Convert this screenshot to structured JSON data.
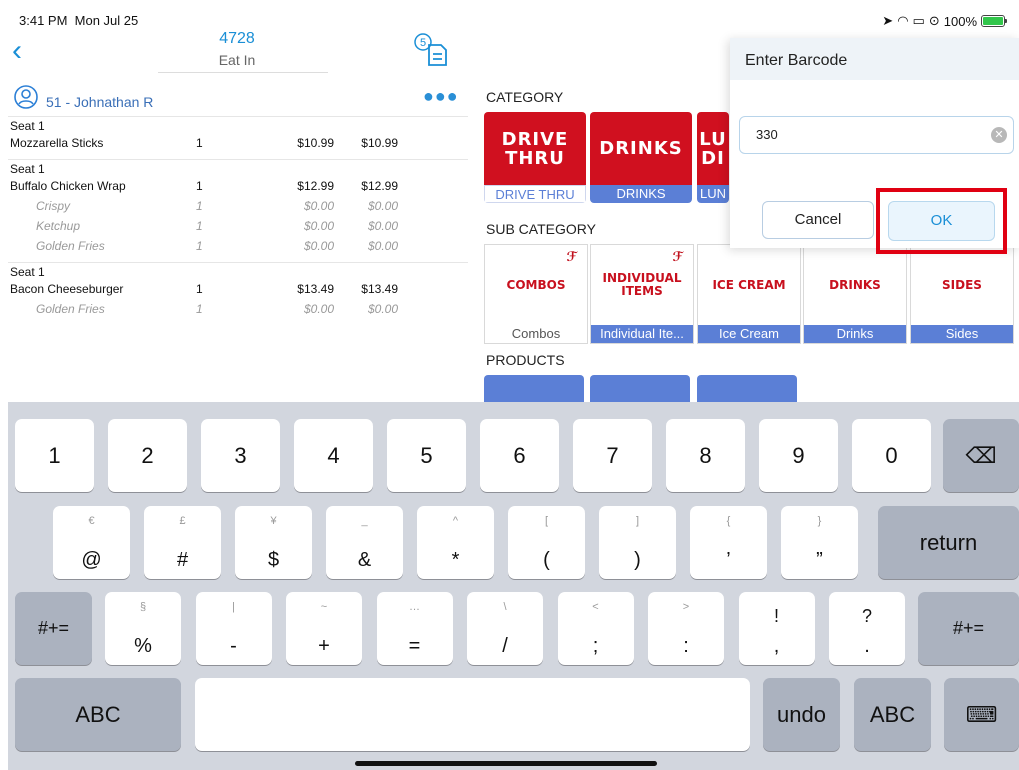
{
  "status": {
    "time": "3:41 PM",
    "date": "Mon Jul 25",
    "battery": "100%",
    "battery_level": 1.0
  },
  "header": {
    "order_number": "4728",
    "order_type": "Eat In",
    "receipt_badge": "5"
  },
  "customer": {
    "name": "51 - Johnathan R"
  },
  "orders": [
    {
      "seat": "Seat 1",
      "lines": [
        {
          "name": "Mozzarella Sticks",
          "qty": "1",
          "price": "$10.99",
          "total": "$10.99",
          "mod": false
        }
      ]
    },
    {
      "seat": "Seat 1",
      "lines": [
        {
          "name": "Buffalo Chicken Wrap",
          "qty": "1",
          "price": "$12.99",
          "total": "$12.99",
          "mod": false
        },
        {
          "name": "Crispy",
          "qty": "1",
          "price": "$0.00",
          "total": "$0.00",
          "mod": true
        },
        {
          "name": "Ketchup",
          "qty": "1",
          "price": "$0.00",
          "total": "$0.00",
          "mod": true
        },
        {
          "name": "Golden Fries",
          "qty": "1",
          "price": "$0.00",
          "total": "$0.00",
          "mod": true
        }
      ]
    },
    {
      "seat": "Seat 1",
      "lines": [
        {
          "name": "Bacon Cheeseburger",
          "qty": "1",
          "price": "$13.49",
          "total": "$13.49",
          "mod": false
        },
        {
          "name": "Golden Fries",
          "qty": "1",
          "price": "$0.00",
          "total": "$0.00",
          "mod": true
        }
      ]
    }
  ],
  "catalog": {
    "category_title": "CATEGORY",
    "categories": [
      {
        "art": "DRIVE\nTHRU",
        "label": "DRIVE THRU"
      },
      {
        "art": "DRINKS",
        "label": "DRINKS"
      },
      {
        "art": "LU\nDI",
        "label": "LUN"
      }
    ],
    "subcategory_title": "SUB CATEGORY",
    "subcategories": [
      {
        "art": "COMBOS",
        "label": "Combos"
      },
      {
        "art": "INDIVIDUAL ITEMS",
        "label": "Individual Ite..."
      },
      {
        "art": "ICE CREAM",
        "label": "Ice Cream"
      },
      {
        "art": "DRINKS",
        "label": "Drinks"
      },
      {
        "art": "SIDES",
        "label": "Sides"
      }
    ],
    "products_title": "PRODUCTS"
  },
  "dialog": {
    "title": "Enter Barcode",
    "barcode_value": "330",
    "cancel_label": "Cancel",
    "ok_label": "OK",
    "highlight_color": "#e00012"
  },
  "keyboard": {
    "row1": [
      "1",
      "2",
      "3",
      "4",
      "5",
      "6",
      "7",
      "8",
      "9",
      "0"
    ],
    "row2": [
      {
        "alt": "€",
        "key": "@"
      },
      {
        "alt": "£",
        "key": "#"
      },
      {
        "alt": "¥",
        "key": "$"
      },
      {
        "alt": "_",
        "key": "&"
      },
      {
        "alt": "^",
        "key": "*"
      },
      {
        "alt": "[",
        "key": "("
      },
      {
        "alt": "]",
        "key": ")"
      },
      {
        "alt": "{",
        "key": "’"
      },
      {
        "alt": "}",
        "key": "”"
      }
    ],
    "return_label": "return",
    "row3": [
      {
        "alt": "§",
        "key": "%"
      },
      {
        "alt": "|",
        "key": "-"
      },
      {
        "alt": "~",
        "key": "+"
      },
      {
        "alt": "…",
        "key": "="
      },
      {
        "alt": "\\",
        "key": "/"
      },
      {
        "alt": "<",
        "key": ";"
      },
      {
        "alt": ">",
        "key": ":"
      },
      {
        "alt": "¡",
        "key": ","
      },
      {
        "alt": "¿",
        "key": "."
      }
    ],
    "row3_top": [
      "",
      "",
      "",
      "",
      "",
      "",
      "",
      "!",
      "?"
    ],
    "shift_label": "#+=",
    "abc_label": "ABC",
    "undo_label": "undo"
  },
  "colors": {
    "accent": "#1a8fd6",
    "tile_caption": "#5b7fd6",
    "brand_red": "#d0101f"
  }
}
